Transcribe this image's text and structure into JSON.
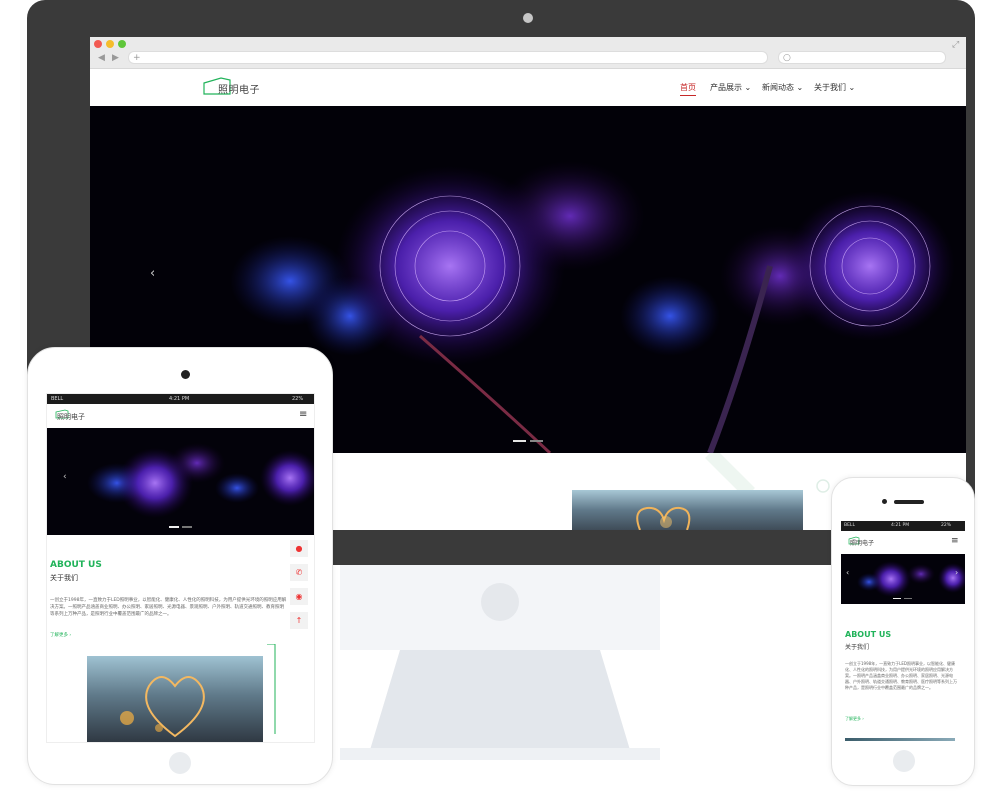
{
  "desktop": {
    "logo": "照明电子",
    "nav": [
      {
        "label": "首页",
        "active": true
      },
      {
        "label": "产品展示",
        "dropdown": true
      },
      {
        "label": "新闻动态",
        "dropdown": true
      },
      {
        "label": "关于我们",
        "dropdown": true
      }
    ],
    "hero_slides": 2,
    "colors": {
      "accent": "#21b35a",
      "nav_active": "#c62828",
      "frame": "#3a3a3a",
      "glow": "#7c3cff"
    }
  },
  "tablet": {
    "status": {
      "carrier": "BELL",
      "time": "4:21 PM",
      "battery": "22%"
    },
    "logo": "照明电子",
    "about_title": "ABOUT US",
    "about_subtitle": "关于我们",
    "about_body": "一创立于1998年，一直致力于LED照明事业，以智能化、健康化、人性化的照明科技，为用户提供光环境的照明应用解决方案。一照明产品涵盖商业照明、办公照明、家居照明、光源电器、景观照明、户外照明、轨道交通照明、教育照明等系列上万种产品，是照明行业中覆盖范围最广的品牌之一。",
    "about_more": "了解更多 ›"
  },
  "phone": {
    "status": {
      "carrier": "BELL",
      "time": "4:21 PM",
      "battery": "22%"
    },
    "logo": "照明电子",
    "about_title": "ABOUT US",
    "about_subtitle": "关于我们",
    "about_body": "一创立于1998年，一直致力于LED照明事业，以智能化、健康化、人性化的照明科技，为用户提供光环境的照明应用解决方案。一照明产品涵盖商业照明、办公照明、家居照明、光源电器、户外照明、轨道交通照明、教育照明、医疗照明等系列上万种产品，是照明行业中覆盖范围最广的品牌之一。",
    "about_more": "了解更多 ›"
  }
}
